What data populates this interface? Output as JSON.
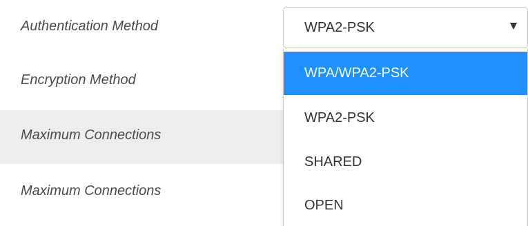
{
  "colors": {
    "highlight": "#1e90ff",
    "shaded_row": "#ededed",
    "label_text": "#4a4a4a"
  },
  "form": {
    "rows": [
      {
        "label": "Authentication Method"
      },
      {
        "label": "Encryption Method"
      },
      {
        "label": "Maximum Connections"
      },
      {
        "label": "Maximum Connections"
      }
    ]
  },
  "auth_select": {
    "value": "WPA2-PSK",
    "caret_icon": "triangle-down-icon",
    "options": [
      {
        "label": "WPA/WPA2-PSK",
        "highlighted": true
      },
      {
        "label": "WPA2-PSK",
        "highlighted": false
      },
      {
        "label": "SHARED",
        "highlighted": false
      },
      {
        "label": "OPEN",
        "highlighted": false
      }
    ]
  }
}
